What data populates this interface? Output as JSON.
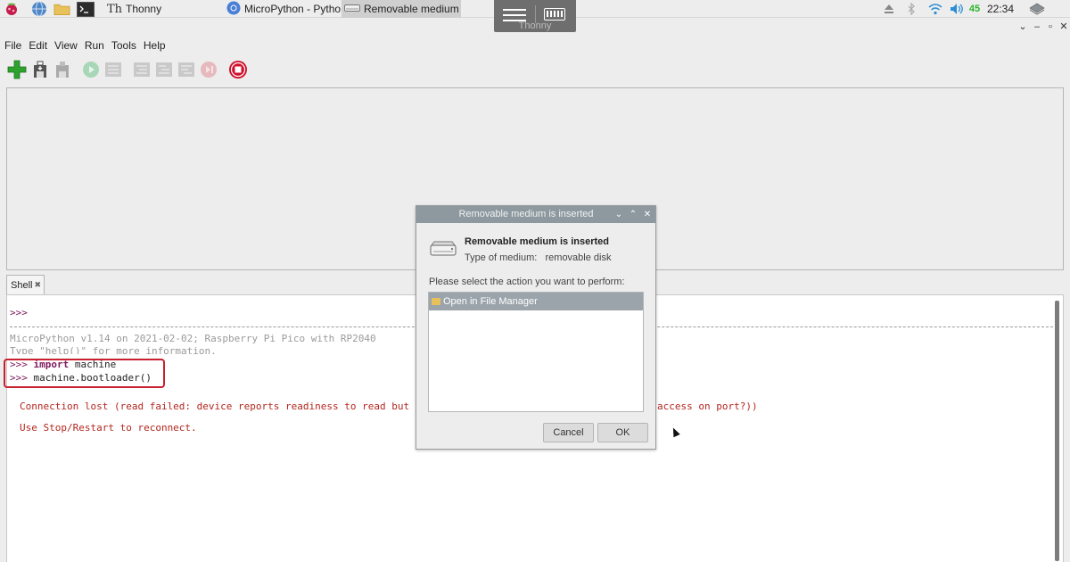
{
  "taskbar": {
    "tasks": [
      {
        "label": "Thonny"
      },
      {
        "label": "MicroPython - Python..."
      },
      {
        "label": "Removable medium i..."
      }
    ],
    "clock": "22:34",
    "volume": "45"
  },
  "vkbd": {
    "label": "Thonny"
  },
  "menu": [
    "File",
    "Edit",
    "View",
    "Run",
    "Tools",
    "Help"
  ],
  "shell": {
    "tab_label": "Shell",
    "prompt": ">>>",
    "banner1": "MicroPython v1.14 on 2021-02-02; Raspberry Pi Pico with RP2040",
    "banner2": "Type \"help()\" for more information.",
    "import_kw": "import",
    "import_mod": " machine",
    "call": " machine.bootloader()",
    "error1_a": "Connection lost (read failed: device reports readiness to read but returned",
    "error1_b": "access on port?))",
    "error2": "Use Stop/Restart to reconnect."
  },
  "dialog": {
    "title": "Removable medium is inserted",
    "heading": "Removable medium is inserted",
    "type_label": "Type of medium:",
    "type_value": "removable disk",
    "prompt": "Please select the action you want to perform:",
    "action": "Open in File Manager",
    "cancel": "Cancel",
    "ok": "OK"
  },
  "colors": {
    "accent": "#c8202e",
    "dialog_title": "#8e999f",
    "stop": "#d0102c"
  },
  "icons": [
    "raspberry-icon",
    "globe-icon",
    "folder-icon",
    "terminal-icon",
    "thonny-icon",
    "chromium-icon",
    "drive-icon",
    "menu-icon",
    "keyboard-icon",
    "eject-icon",
    "bluetooth-icon",
    "wifi-icon",
    "volume-icon",
    "network-icon"
  ]
}
